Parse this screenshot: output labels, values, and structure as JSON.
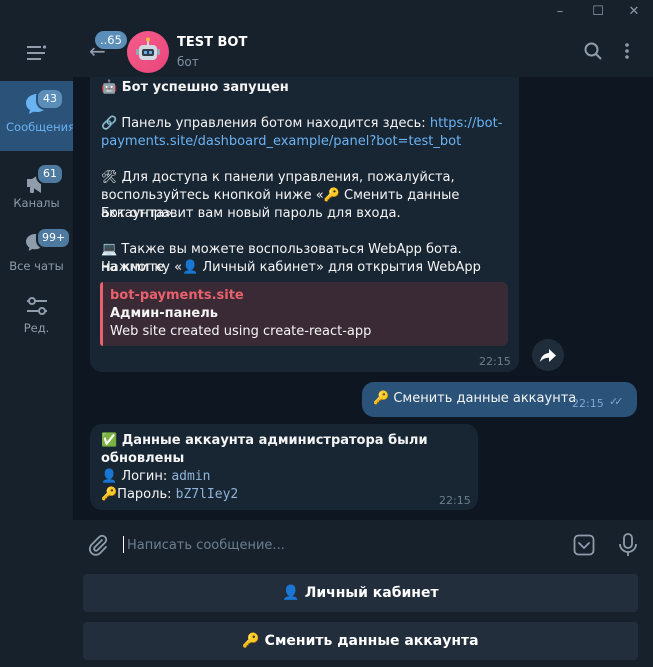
{
  "window": {
    "minimize_glyph": "–",
    "maximize_glyph": "☐",
    "close_glyph": "✕"
  },
  "sidebar": {
    "items": [
      {
        "label": "Сообщения",
        "badge": "43",
        "icon": "chat-bubble-icon",
        "active": true
      },
      {
        "label": "Каналы",
        "badge": "61",
        "icon": "megaphone-icon",
        "active": false
      },
      {
        "label": "Все чаты",
        "badge": "99+",
        "icon": "chats-icon",
        "active": false
      },
      {
        "label": "Ред.",
        "badge": "",
        "icon": "sliders-icon",
        "active": false
      }
    ]
  },
  "header": {
    "unread_count": "..65",
    "title": "TEST BOT",
    "subtitle": "бот"
  },
  "messages": {
    "m1": {
      "line1": "🤖 Бот успешно запущен",
      "line2_prefix": "🔗 Панель управления ботом находится здесь: ",
      "line2_link_a": "https://bot-",
      "line2_link_b": "payments.site/dashboard_example/panel?bot=test_bot",
      "line3a": "🛠 Для доступа к панели управления, пожалуйста,",
      "line3b": "воспользуйтесь кнопкой ниже «🔑 Сменить данные аккаунта».",
      "line3c": "Бот отправит вам новый пароль для входа.",
      "line4a": "💻 Также вы можете воспользоваться WebApp бота. Нажмите",
      "line4b": "на кнопку «👤 Личный кабинет» для открытия WebApp",
      "preview_site": "bot-payments.site",
      "preview_title": "Админ-панель",
      "preview_desc": "Web site created using create-react-app",
      "time": "22:15"
    },
    "m2": {
      "text": "🔑 Сменить данные аккаунта",
      "time": "22:15",
      "status": "✓✓"
    },
    "m3": {
      "title": "✅ Данные аккаунта администратора были обновлены",
      "login_label": "👤 Логин: ",
      "login_value": "admin",
      "password_label": "🔑Пароль: ",
      "password_value": "bZ7lIey2",
      "time": "22:15"
    }
  },
  "composer": {
    "placeholder": "Написать сообщение..."
  },
  "keyboard": {
    "buttons": [
      "👤 Личный кабинет",
      "🔑 Сменить данные аккаунта"
    ]
  },
  "colors": {
    "accent": "#6ab3f3",
    "active_rail": "#2b5278",
    "background": "#0e1621",
    "panel": "#17212b"
  }
}
